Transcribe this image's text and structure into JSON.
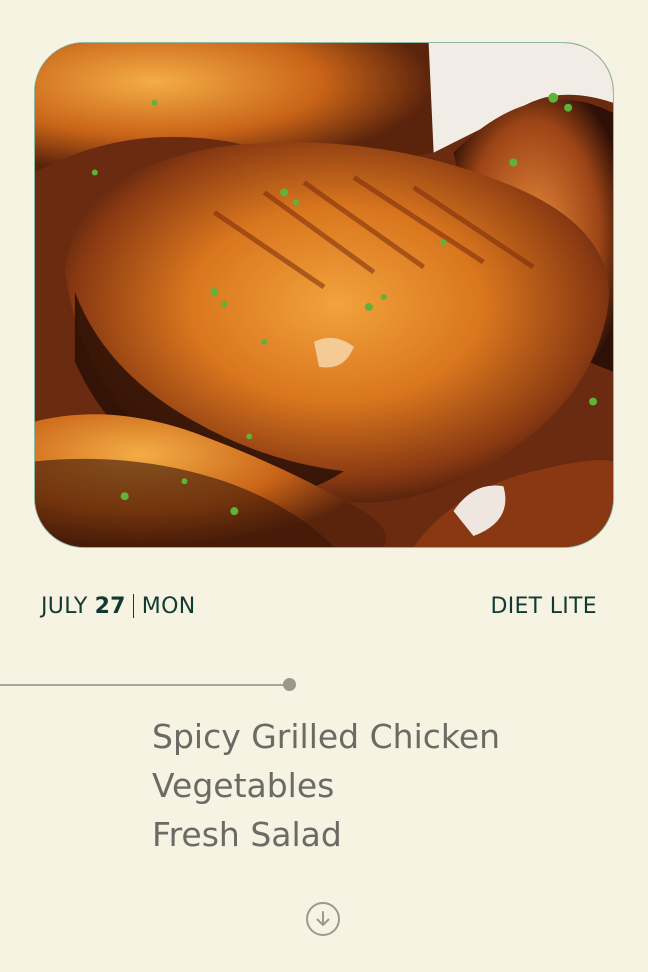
{
  "hero": {
    "image_alt": "grilled-chicken-photo"
  },
  "date": {
    "month": "JULY",
    "day": "27",
    "weekday": "MON"
  },
  "plan": {
    "name": "DIET LITE"
  },
  "menu": {
    "items": [
      "Spicy Grilled Chicken",
      "Vegetables",
      "Fresh Salad"
    ]
  },
  "scroll": {
    "icon": "arrow-down-circle-icon"
  },
  "colors": {
    "background": "#f6f3e2",
    "text_dark": "#123a32",
    "text_muted": "#6b6b66",
    "divider": "#a7a498"
  }
}
